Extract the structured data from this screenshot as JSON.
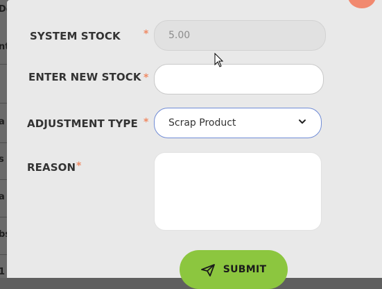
{
  "background_fragments": [
    "De",
    "nt",
    "a",
    "s",
    "a",
    "bs",
    "1"
  ],
  "form": {
    "system_stock": {
      "label": "SYSTEM STOCK",
      "required_mark": "*",
      "value": "5.00"
    },
    "new_stock": {
      "label": "ENTER NEW STOCK",
      "required_mark": "*",
      "value": ""
    },
    "adjustment_type": {
      "label": "ADJUSTMENT TYPE",
      "required_mark": "*",
      "selected": "Scrap Product"
    },
    "reason": {
      "label": "REASON",
      "required_mark": "*",
      "value": ""
    },
    "submit_label": "SUBMIT"
  },
  "icons": {
    "chevron": "chevron-down-icon",
    "submit": "paper-plane-icon",
    "close": "close-icon",
    "cursor": "mouse-cursor-icon"
  },
  "colors": {
    "accent_required": "#ef8a64",
    "submit_bg": "#8cc63f",
    "select_border": "#6f8bd6",
    "close_bg": "#f1896f"
  }
}
